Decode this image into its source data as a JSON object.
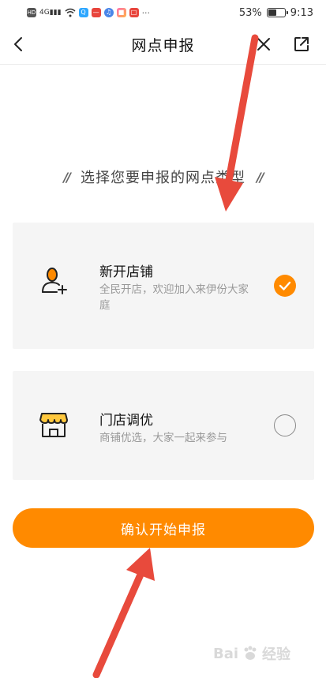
{
  "status_bar": {
    "battery": "53%",
    "battery_level": 0.53,
    "time": "9:13",
    "icons": [
      "hd-icon",
      "4g-signal-icon",
      "wifi-icon",
      "app-icons",
      "more-dots"
    ]
  },
  "nav": {
    "title": "网点申报",
    "icons": [
      "back-icon",
      "close-icon",
      "share-icon"
    ]
  },
  "section": {
    "header": "选择您要申报的网点类型"
  },
  "options": [
    {
      "title": "新开店铺",
      "desc": "全民开店，欢迎加入来伊份大家庭",
      "selected": true,
      "icon": "user-add-icon"
    },
    {
      "title": "门店调优",
      "desc": "商铺优选，大家一起来参与",
      "selected": false,
      "icon": "storefront-icon"
    }
  ],
  "confirm": {
    "label": "确认开始申报"
  },
  "colors": {
    "accent": "#ff8a00",
    "card_bg": "#f5f5f5",
    "annotation_arrow": "#e84a3c"
  }
}
